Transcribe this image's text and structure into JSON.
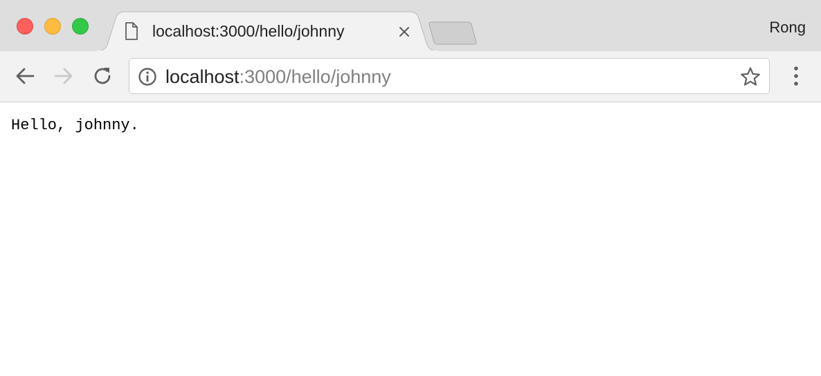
{
  "window": {
    "controls": {
      "close_color": "#fc605c",
      "minimize_color": "#fdbc40",
      "zoom_color": "#34c84a"
    },
    "profile_name": "Rong"
  },
  "tab": {
    "title": "localhost:3000/hello/johnny",
    "icon": "page-icon",
    "close_icon": "close-icon"
  },
  "toolbar": {
    "back_icon": "arrow-left-icon",
    "forward_icon": "arrow-right-icon",
    "reload_icon": "reload-icon",
    "menu_icon": "vertical-dots-icon"
  },
  "omnibox": {
    "info_icon": "info-icon",
    "url_host": "localhost",
    "url_rest": ":3000/hello/johnny",
    "bookmark_icon": "star-icon"
  },
  "page": {
    "text": "Hello, johnny."
  }
}
